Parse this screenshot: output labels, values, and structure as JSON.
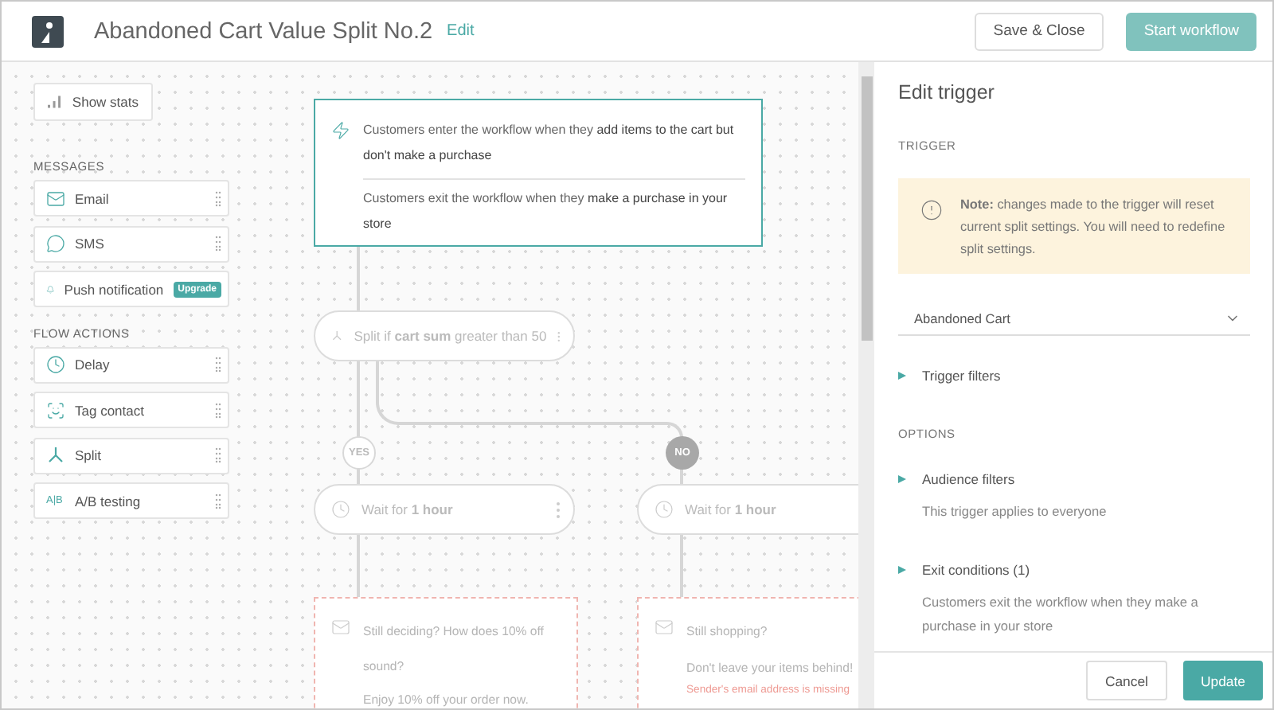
{
  "header": {
    "title": "Abandoned Cart Value Split No.2",
    "edit_link": "Edit",
    "buttons": [
      {
        "label": "Save & Close",
        "kind": "secondary"
      },
      {
        "label": "Start workflow",
        "kind": "primary",
        "disabled": true
      }
    ]
  },
  "palette": {
    "show_stats": "Show stats",
    "sections": [
      {
        "title": "MESSAGES",
        "items": [
          {
            "label": "Email",
            "kind": "email"
          },
          {
            "label": "SMS",
            "kind": "sms"
          },
          {
            "label": "Push notification",
            "kind": "push",
            "badge": "Upgrade"
          }
        ]
      },
      {
        "title": "FLOW ACTIONS",
        "items": [
          {
            "label": "Delay",
            "kind": "delay"
          },
          {
            "label": "Tag contact",
            "kind": "tag"
          },
          {
            "label": "Split",
            "kind": "split"
          },
          {
            "label": "A/B testing",
            "kind": "ab",
            "glyph": "A|B"
          }
        ]
      }
    ]
  },
  "canvas": {
    "trigger": {
      "enter": "Customers enter the workflow when they **add items to the cart but don't make a purchase**",
      "exit": "Customers exit the workflow when they **make a purchase in your store**"
    },
    "split": "Split if **cart sum** greater than 50",
    "branches": [
      {
        "label": "YES",
        "selected": false,
        "wait": "Wait for **1 hour**",
        "email_subject": "Still deciding? How does 10% off sound?",
        "email_preview": "Enjoy 10% off your order now."
      },
      {
        "label": "NO",
        "selected": true,
        "wait": "Wait for **1 hour**",
        "email_subject": "Still shopping?",
        "email_preview": "Don't leave your items behind!",
        "error": "Sender's email address is missing"
      }
    ]
  },
  "panel": {
    "title": "Edit trigger",
    "trigger_label": "TRIGGER",
    "note": "**Note:** changes made to the trigger will reset current split settings. You will need to redefine split settings.",
    "trigger_select": "Abandoned Cart",
    "trigger_filters": {
      "label": "Trigger filters",
      "expanded": false
    },
    "options_label": "OPTIONS",
    "options": [
      {
        "label": "Audience filters",
        "expanded": false,
        "description": "This trigger applies to everyone"
      },
      {
        "label": "Exit conditions (1)",
        "expanded": false,
        "description": "Customers exit the workflow when they make a purchase in your store"
      }
    ],
    "footer": [
      {
        "label": "Cancel",
        "kind": "secondary"
      },
      {
        "label": "Update",
        "kind": "primary"
      }
    ]
  }
}
